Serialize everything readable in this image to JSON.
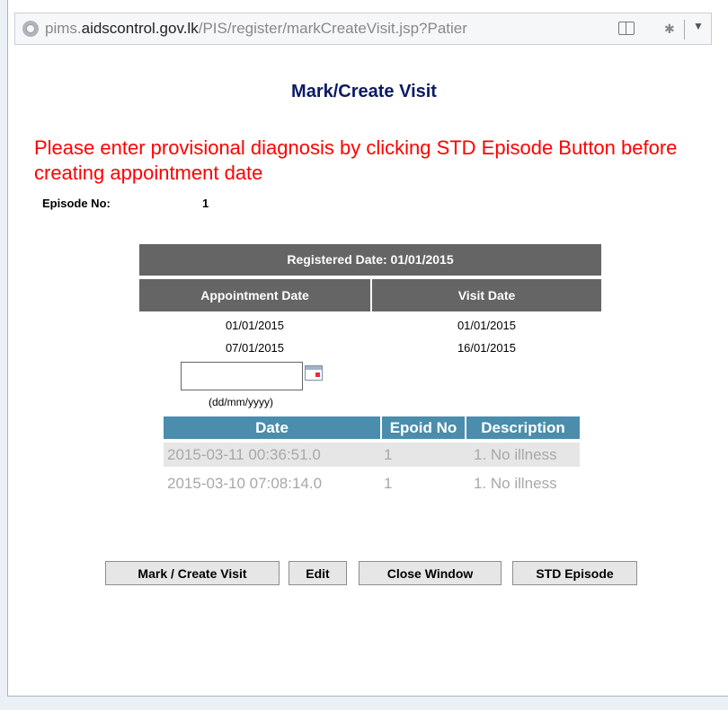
{
  "browser": {
    "url_prefix": "pims.",
    "url_domain": "aidscontrol.gov.lk",
    "url_path": "/PIS/register/markCreateVisit.jsp?Patier"
  },
  "page": {
    "title": "Mark/Create Visit",
    "warning": "Please enter provisional diagnosis by clicking STD Episode Button before creating appointment date",
    "episode_label": "Episode No:",
    "episode_value": "1"
  },
  "visits": {
    "registered": "Registered Date: 01/01/2015",
    "headers": [
      "Appointment Date",
      "Visit Date"
    ],
    "rows": [
      {
        "appointment": "01/01/2015",
        "visit": "01/01/2015"
      },
      {
        "appointment": "07/01/2015",
        "visit": "16/01/2015"
      }
    ],
    "date_input_value": "",
    "date_format_hint": "(dd/mm/yyyy)"
  },
  "history": {
    "headers": [
      "Date",
      "Epoid No",
      "Description"
    ],
    "rows": [
      {
        "date": "2015-03-11 00:36:51.0",
        "epoid": "1",
        "description": "1. No illness"
      },
      {
        "date": "2015-03-10 07:08:14.0",
        "epoid": "1",
        "description": "1. No illness"
      }
    ]
  },
  "buttons": {
    "mark": "Mark / Create Visit",
    "edit": "Edit",
    "close": "Close Window",
    "std": "STD Episode"
  },
  "colors": {
    "title": "#0b1a66",
    "warning": "#ff0000",
    "table_header": "#656565",
    "history_header": "#4a8dac"
  }
}
